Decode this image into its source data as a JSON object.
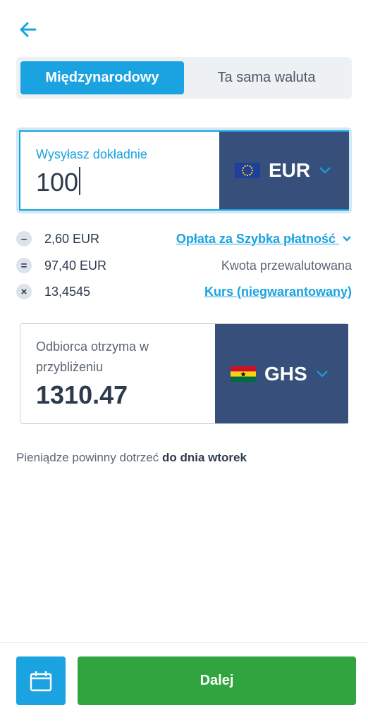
{
  "tabs": {
    "active": "Międzynarodowy",
    "inactive": "Ta sama waluta"
  },
  "send": {
    "label": "Wysyłasz dokładnie",
    "amount": "100",
    "currency": "EUR"
  },
  "breakdown": [
    {
      "op": "–",
      "amount": "2,60 EUR",
      "label": "Opłata za Szybka płatność"
    },
    {
      "op": "=",
      "amount": "97,40 EUR",
      "label": "Kwota przewalutowana"
    },
    {
      "op": "×",
      "amount": "13,4545",
      "label": "Kurs (niegwarantowany)"
    }
  ],
  "receive": {
    "label": "Odbiorca otrzyma w przybliżeniu",
    "amount": "1310.47",
    "currency": "GHS"
  },
  "eta": {
    "text": "Pieniądze powinny dotrzeć",
    "bold": "do dnia wtorek"
  },
  "actions": {
    "next_label": "Dalej"
  },
  "colors": {
    "accent": "#1aa3e0",
    "currency_bg": "#37507b",
    "primary_button": "#30a53f"
  },
  "icons": {
    "back": "arrow-left-icon",
    "calendar": "calendar-icon",
    "chevron": "chevron-down-icon",
    "eu_flag": "eu-flag-icon",
    "ghana_flag": "ghana-flag-icon"
  }
}
